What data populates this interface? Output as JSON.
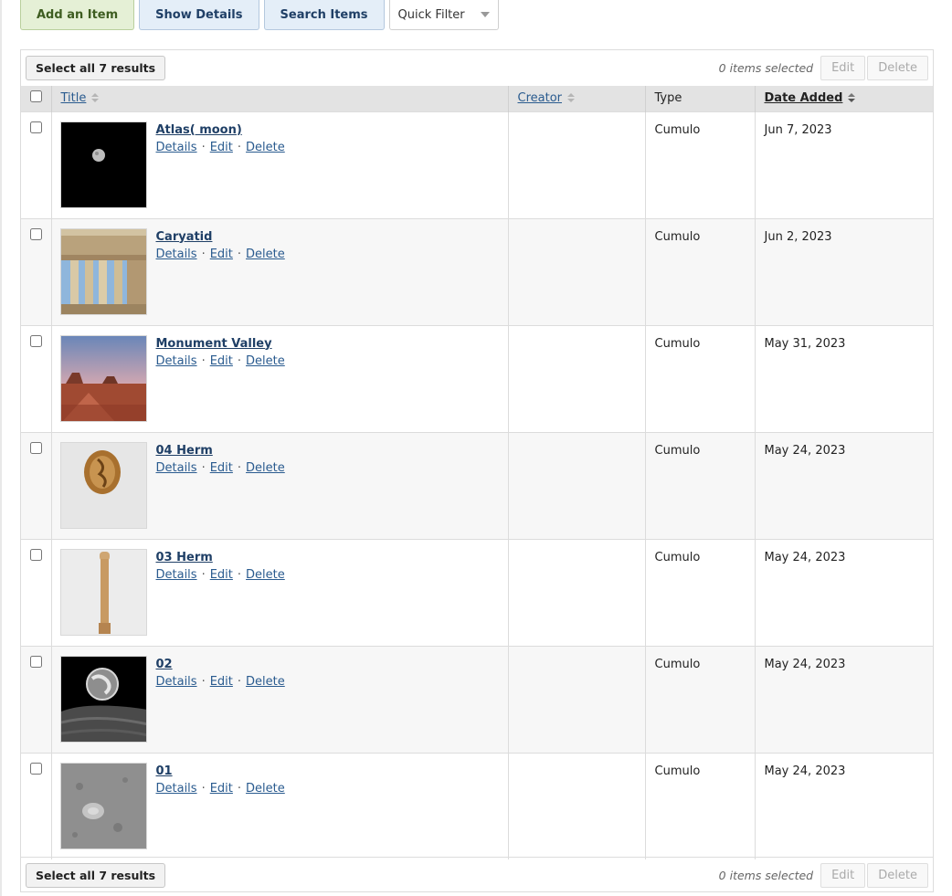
{
  "toolbar": {
    "add_label": "Add an Item",
    "details_label": "Show Details",
    "search_label": "Search Items",
    "quick_filter_label": "Quick Filter"
  },
  "batch": {
    "select_all_label": "Select all 7 results",
    "selected_text": "0 items selected",
    "edit_label": "Edit",
    "delete_label": "Delete"
  },
  "table": {
    "columns": {
      "title": "Title",
      "creator": "Creator",
      "type": "Type",
      "date_added": "Date Added"
    },
    "sorted_by": "date_added",
    "row_actions": {
      "details": "Details",
      "edit": "Edit",
      "delete": "Delete"
    },
    "rows": [
      {
        "title": "Atlas( moon)",
        "creator": "",
        "type": "Cumulo",
        "date": "Jun 7, 2023",
        "thumb": "moon-small"
      },
      {
        "title": "Caryatid",
        "creator": "",
        "type": "Cumulo",
        "date": "Jun 2, 2023",
        "thumb": "caryatid"
      },
      {
        "title": "Monument Valley",
        "creator": "",
        "type": "Cumulo",
        "date": "May 31, 2023",
        "thumb": "monument-valley"
      },
      {
        "title": "04 Herm",
        "creator": "",
        "type": "Cumulo",
        "date": "May 24, 2023",
        "thumb": "herm-coin"
      },
      {
        "title": "03 Herm",
        "creator": "",
        "type": "Cumulo",
        "date": "May 24, 2023",
        "thumb": "herm-pillar"
      },
      {
        "title": "02",
        "creator": "",
        "type": "Cumulo",
        "date": "May 24, 2023",
        "thumb": "earthrise"
      },
      {
        "title": "01",
        "creator": "",
        "type": "Cumulo",
        "date": "May 24, 2023",
        "thumb": "moon-surface"
      }
    ]
  }
}
